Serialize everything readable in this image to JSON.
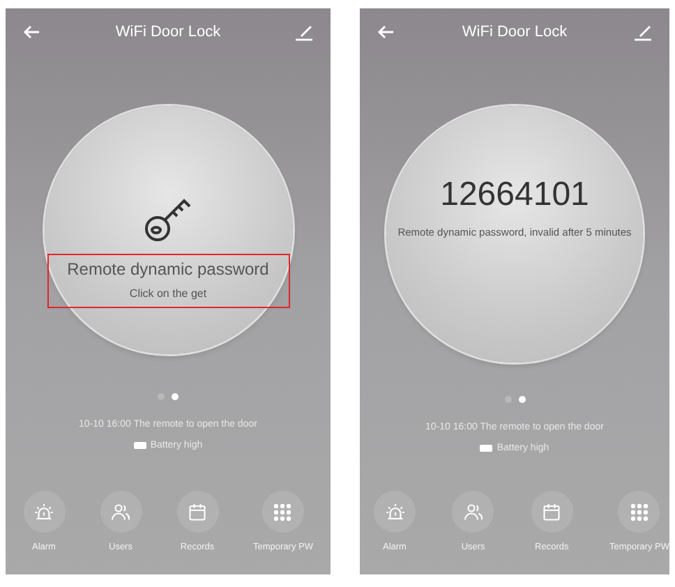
{
  "screens": [
    {
      "kind": "key-prompt",
      "title": "WiFi Door Lock",
      "heading": "Remote dynamic password",
      "subtext": "Click on the get",
      "highlighted": true,
      "pages": [
        {
          "selected": false
        },
        {
          "selected": true
        }
      ],
      "event": "10-10 16:00  The remote to open the door",
      "battery": "Battery high",
      "nav": [
        {
          "kind": "alarm",
          "label": "Alarm"
        },
        {
          "kind": "users",
          "label": "Users"
        },
        {
          "kind": "records",
          "label": "Records"
        },
        {
          "kind": "grid",
          "label": "Temporary PW"
        }
      ]
    },
    {
      "kind": "code",
      "title": "WiFi Door Lock",
      "heading": "12664101",
      "subtext": "Remote dynamic password, invalid after 5 minutes",
      "highlighted": false,
      "pages": [
        {
          "selected": false
        },
        {
          "selected": true
        }
      ],
      "event": "10-10 16:00  The remote to open the door",
      "battery": "Battery high",
      "nav": [
        {
          "kind": "alarm",
          "label": "Alarm"
        },
        {
          "kind": "users",
          "label": "Users"
        },
        {
          "kind": "records",
          "label": "Records"
        },
        {
          "kind": "grid",
          "label": "Temporary PW"
        }
      ]
    }
  ]
}
